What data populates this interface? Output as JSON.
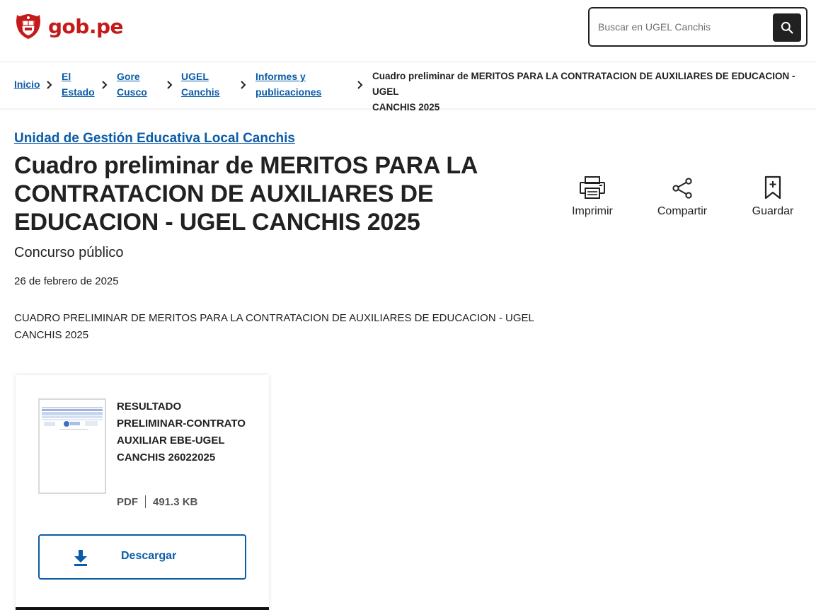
{
  "header": {
    "logo_text": "gob.pe",
    "logo_icon": "peru-coat-of-arms-icon",
    "search_placeholder": "Buscar en UGEL Canchis",
    "search_icon": "search-icon"
  },
  "breadcrumb": {
    "items": [
      {
        "label": "Inicio"
      },
      {
        "label_line1": "El",
        "label_line2": "Estado"
      },
      {
        "label_line1": "Gore",
        "label_line2": "Cusco"
      },
      {
        "label_line1": "UGEL",
        "label_line2": "Canchis"
      },
      {
        "label_line1": "Informes y",
        "label_line2": "publicaciones"
      }
    ],
    "current_line1": "Cuadro preliminar de MERITOS PARA LA CONTRATACION DE AUXILIARES DE EDUCACION - UGEL",
    "current_line2": "CANCHIS 2025"
  },
  "main": {
    "unit": "Unidad de Gestión Educativa Local Canchis",
    "title": "Cuadro preliminar de MERITOS PARA LA CONTRATACION DE AUXILIARES DE EDUCACION - UGEL CANCHIS 2025",
    "subtitle": "Concurso público",
    "date": "26 de febrero de 2025",
    "description": "CUADRO PRELIMINAR DE MERITOS PARA LA CONTRATACION DE AUXILIARES DE EDUCACION - UGEL CANCHIS 2025"
  },
  "actions": {
    "print": {
      "label": "Imprimir",
      "icon": "printer-icon"
    },
    "share": {
      "label": "Compartir",
      "icon": "share-icon"
    },
    "save": {
      "label": "Guardar",
      "icon": "bookmark-icon"
    }
  },
  "document": {
    "name": "RESULTADO PRELIMINAR-CONTRATO AUXILIAR EBE-UGEL CANCHIS 26022025",
    "type": "PDF",
    "size": "491.3 KB",
    "download_label": "Descargar",
    "download_icon": "download-icon"
  },
  "colors": {
    "brand_red": "#c41a1a",
    "link_blue": "#0b5ca8",
    "text": "#212121"
  }
}
